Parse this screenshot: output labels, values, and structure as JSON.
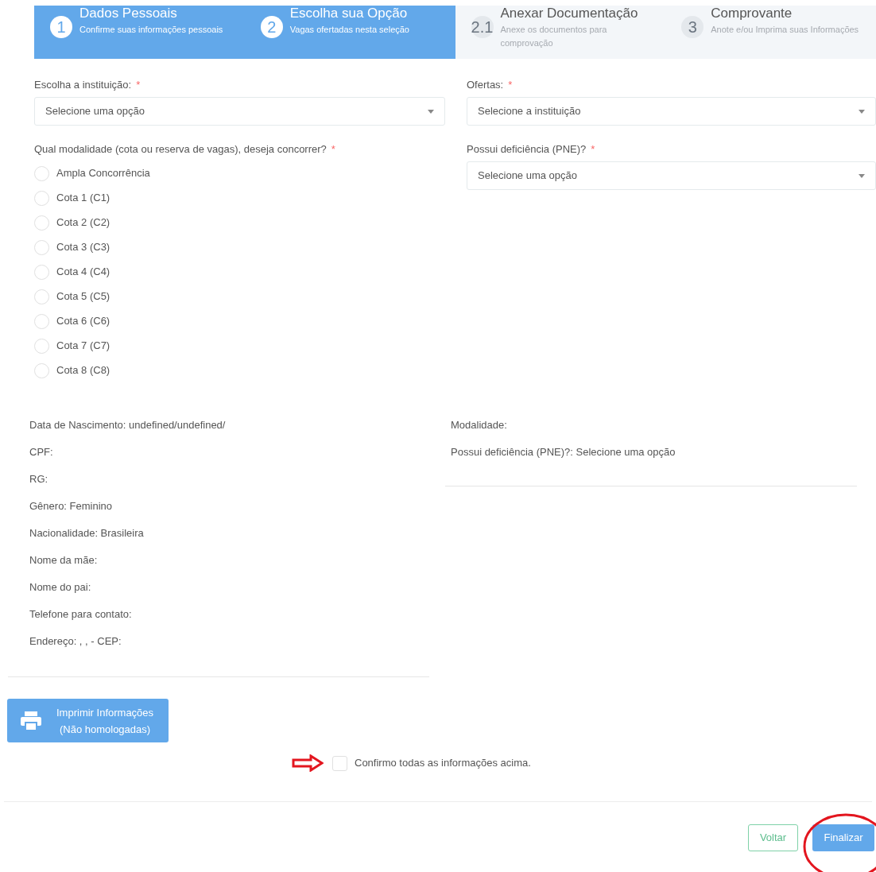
{
  "steps": [
    {
      "number": "1",
      "title": "Dados Pessoais",
      "subtitle": "Confirme suas informações pessoais",
      "completed": true
    },
    {
      "number": "2",
      "title": "Escolha sua Opção",
      "subtitle": "Vagas ofertadas nesta seleção",
      "completed": true
    },
    {
      "number": "2.1",
      "title": "Anexar Documentação",
      "subtitle": "Anexe os documentos para comprovação",
      "completed": false
    },
    {
      "number": "3",
      "title": "Comprovante",
      "subtitle": "Anote e/ou Imprima suas Informações",
      "completed": false
    }
  ],
  "institution": {
    "label": "Escolha a instituição:",
    "required_mark": "*",
    "placeholder": "Selecione uma opção"
  },
  "offers": {
    "label": "Ofertas:",
    "required_mark": "*",
    "placeholder": "Selecione a instituição"
  },
  "modality": {
    "label": "Qual modalidade (cota ou reserva de vagas), deseja concorrer?",
    "required_mark": "*",
    "options": [
      {
        "label": "Ampla Concorrência",
        "selected": false
      },
      {
        "label": "Cota 1 (C1)",
        "selected": false
      },
      {
        "label": "Cota 2 (C2)",
        "selected": false
      },
      {
        "label": "Cota 3 (C3)",
        "selected": false
      },
      {
        "label": "Cota 4 (C4)",
        "selected": false
      },
      {
        "label": "Cota 5 (C5)",
        "selected": false
      },
      {
        "label": "Cota 6 (C6)",
        "selected": false
      },
      {
        "label": "Cota 7 (C7)",
        "selected": false
      },
      {
        "label": "Cota 8 (C8)",
        "selected": false
      }
    ]
  },
  "pne": {
    "label": "Possui deficiência (PNE)?",
    "required_mark": "*",
    "placeholder": "Selecione uma opção"
  },
  "summary_left": [
    "Data de Nascimento: undefined/undefined/",
    "CPF:",
    "RG:",
    "Gênero: Feminino",
    "Nacionalidade: Brasileira",
    "Nome da mãe:",
    "Nome do pai:",
    "Telefone para contato:",
    "Endereço: , , - CEP:"
  ],
  "summary_right": [
    "Modalidade:",
    "Possui deficiência (PNE)?: Selecione uma opção"
  ],
  "print_button": {
    "line_1": "Imprimir Informações",
    "line_2": "(Não homologadas)"
  },
  "confirm": {
    "label": "Confirmo todas as informações acima.",
    "checked": false
  },
  "buttons": {
    "back": "Voltar",
    "finish": "Finalizar"
  }
}
